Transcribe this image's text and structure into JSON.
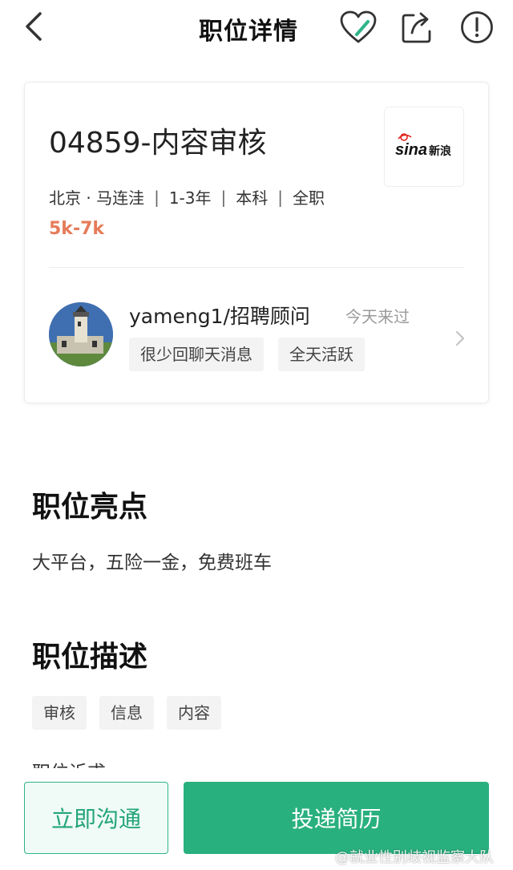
{
  "header": {
    "title": "职位详情"
  },
  "job": {
    "title": "04859-内容审核",
    "meta": [
      "北京 · 马连洼",
      "1-3年",
      "本科",
      "全职"
    ],
    "meta_separator": "|",
    "salary": "5k-7k",
    "company_logo_text": "sina",
    "company_logo_text_cn": "新浪"
  },
  "recruiter": {
    "name": "yameng1/招聘顾问",
    "last_seen": "今天来过",
    "tags": [
      "很少回聊天消息",
      "全天活跃"
    ]
  },
  "highlights": {
    "title": "职位亮点",
    "text": "大平台，五险一金，免费班车"
  },
  "description": {
    "title": "职位描述",
    "tags": [
      "审核",
      "信息",
      "内容"
    ],
    "partial_text": "职位诉求"
  },
  "actions": {
    "chat_label": "立即沟通",
    "apply_label": "投递简历"
  },
  "watermark": "@就业性别歧视监察大队",
  "colors": {
    "accent": "#29b07f",
    "salary": "#e57b5a"
  }
}
